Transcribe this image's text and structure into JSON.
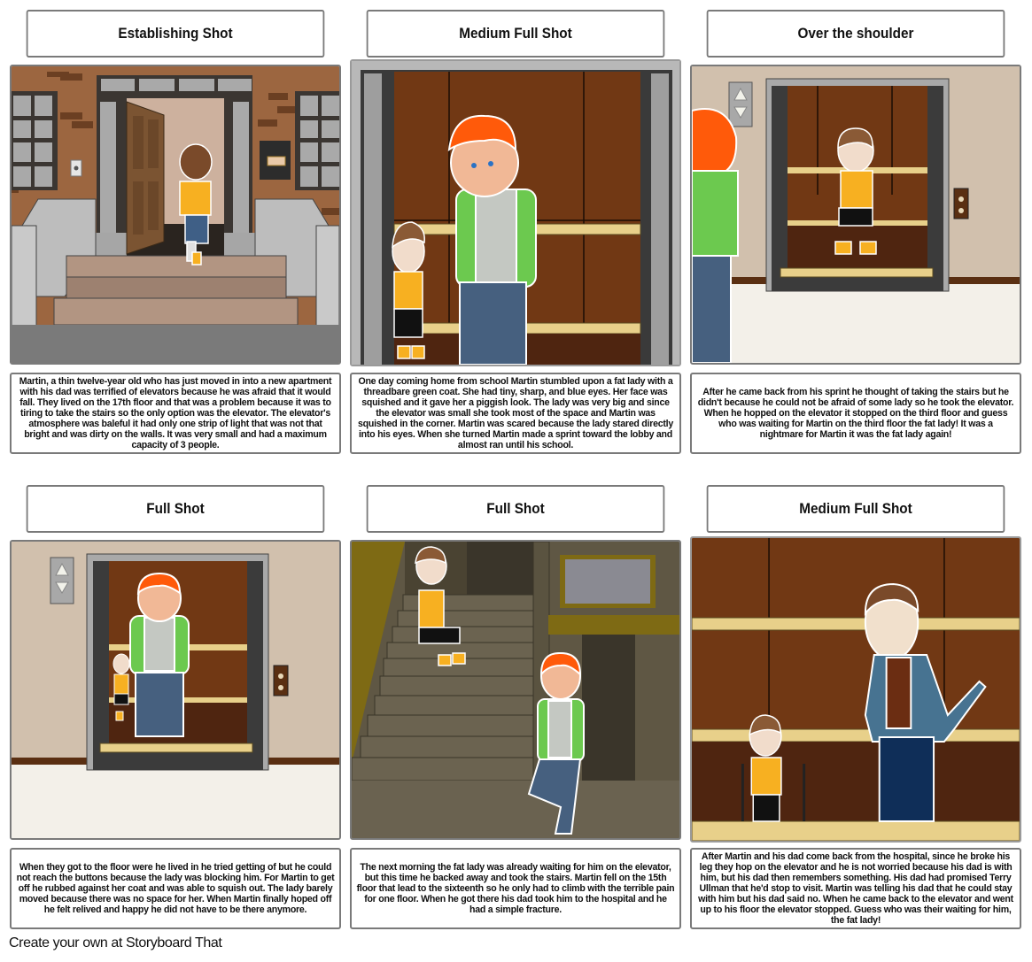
{
  "storyboard": {
    "cells": [
      {
        "title": "Establishing Shot",
        "scene": "Martin walking through the open front door of an apartment building, brick facade, stoop steps",
        "caption": "Martin, a thin twelve-year old who has just moved in into a new apartment with his dad was terrified of elevators because he was afraid that it would fall. They lived on the 17th floor and that was a problem because it was to tiring to take the stairs so the only option was the elevator. The elevator's atmosphere was baleful it had only one strip of light that was not that bright and was dirty on the walls. It was very small and had a maximum capacity of 3 people."
      },
      {
        "title": "Medium Full Shot",
        "scene": "Red-haired lady in a green coat inside the wood-paneled elevator, Martin squeezed in the corner",
        "caption": "One day coming home from school Martin stumbled upon a fat lady with a threadbare green coat. She had tiny, sharp, and blue eyes. Her face was squished and it gave her a piggish look. The lady was very big and since the elevator was small she took most of the space and Martin was squished in the corner. Martin was scared because the lady stared directly into his eyes. When she turned Martin made a sprint toward the lobby and almost ran until his school."
      },
      {
        "title": "Over the shoulder",
        "scene": "Over the lady's shoulder, Martin standing in the open elevator looking scared",
        "caption": "After he came back from his sprint he thought of taking the stairs but he didn't because he could not be afraid of some lady so he took the elevator.  When he hopped on the elevator it stopped on the third floor and guess who was waiting for Martin on the third floor the fat lady! It was a nightmare for Martin it was the fat lady again!"
      },
      {
        "title": "Full Shot",
        "scene": "Lady fills the open elevator, small Martin squeezed at her side",
        "caption": "When they got to the floor were he lived in he tried getting of but he could not reach the buttons because the lady was blocking him. For Martin to get off he rubbed  against her coat and was able to squish out. The lady barely moved because there was no space for her. When Martin finally  hoped off he felt relived and happy he did not have to be there anymore."
      },
      {
        "title": "Full Shot",
        "scene": "Martin crying on the staircase while the lady laughs at the bottom",
        "caption": "The next morning the fat lady was already waiting for him on the elevator, but this time he backed away and took the stairs. Martin fell on the 15th floor that lead to the sixteenth so he only had to climb with the terrible pain for one floor. When he got there his dad took him to the hospital and he had a simple fracture."
      },
      {
        "title": "Medium Full Shot",
        "scene": "Martin on crutches in the elevator next to his angry-looking dad",
        "caption": "After Martin and his dad come back from the hospital, since he broke his leg they hop on the elevator and he is not worried because his dad is with him, but his dad then remembers something. His dad had promised Terry Ullman that he'd stop to visit. Martin was telling his dad that he could stay with him but his dad said no. When he came back to the elevator and went up to his floor the elevator stopped. Guess who was their waiting for him, the fat lady!"
      }
    ]
  },
  "footer": {
    "text": "Create your own at Storyboard That"
  },
  "colors": {
    "border": "#7a7a7a",
    "brick": "#9c6640",
    "elevator_wood": "#713814",
    "elevator_wood_dark": "#4f2510",
    "brass_rail": "#e8d08a",
    "lobby_wall": "#d1c0ad",
    "lobby_floor": "#f3f0e9",
    "stair_wall": "#5f5744",
    "coat_green": "#6cc94f",
    "hair_orange": "#ff5a0a",
    "jersey_yellow": "#f7b021",
    "jeans_blue": "#46607f"
  }
}
